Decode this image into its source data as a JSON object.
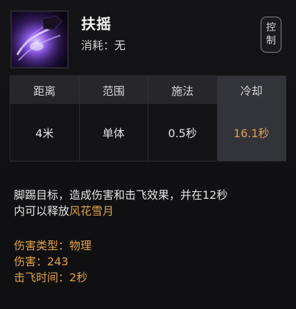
{
  "skill": {
    "name": "扶摇",
    "cost_label": "消耗：",
    "cost_value": "无",
    "tag_chars": [
      "控",
      "制"
    ],
    "icon": "purple-kick-swirl-icon"
  },
  "stats": {
    "headers": [
      "距离",
      "范围",
      "施法",
      "冷却"
    ],
    "values": [
      "4米",
      "单体",
      "0.5秒",
      "16.1秒"
    ]
  },
  "description": {
    "line1": "脚踢目标，造成伤害和击飞效果，并在12秒",
    "line2_prefix": "内可以释放",
    "line2_highlight": "风花雪月"
  },
  "attributes": [
    {
      "label": "伤害类型：",
      "value": "物理"
    },
    {
      "label": "伤害：",
      "value": "243"
    },
    {
      "label": "击飞时间：",
      "value": "2秒"
    }
  ],
  "colors": {
    "gold": "#e2a24b",
    "text": "#e4e4e4",
    "background": "#0f0f11"
  }
}
